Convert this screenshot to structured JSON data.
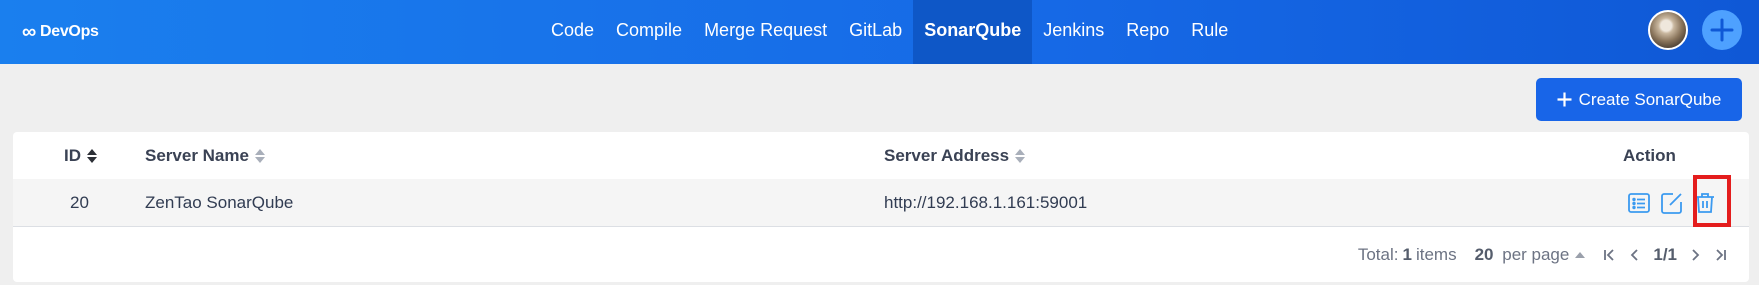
{
  "app": {
    "logo_symbol": "∞",
    "logo_text": "DevOps"
  },
  "nav": {
    "items": [
      {
        "label": "Code"
      },
      {
        "label": "Compile"
      },
      {
        "label": "Merge Request"
      },
      {
        "label": "GitLab"
      },
      {
        "label": "SonarQube",
        "active": true
      },
      {
        "label": "Jenkins"
      },
      {
        "label": "Repo"
      },
      {
        "label": "Rule"
      }
    ]
  },
  "toolbar": {
    "create_label": "Create SonarQube",
    "create_icon": "plus-icon"
  },
  "table": {
    "columns": [
      "ID",
      "Server Name",
      "Server Address",
      "Action"
    ],
    "rows": [
      {
        "id": "20",
        "name": "ZenTao SonarQube",
        "address": "http://192.168.1.161:59001"
      }
    ],
    "row_actions": [
      "list-icon",
      "edit-icon",
      "trash-icon"
    ]
  },
  "pager": {
    "total_prefix": "Total:",
    "total_count": "1",
    "total_suffix": "items",
    "per_page_count": "20",
    "per_page_suffix": "per page",
    "page": "1/1"
  },
  "colors": {
    "accent": "#1865e8",
    "nav_active": "#0e57c7",
    "action_icon": "#3b9af0",
    "highlight_box": "#e41d1d"
  }
}
